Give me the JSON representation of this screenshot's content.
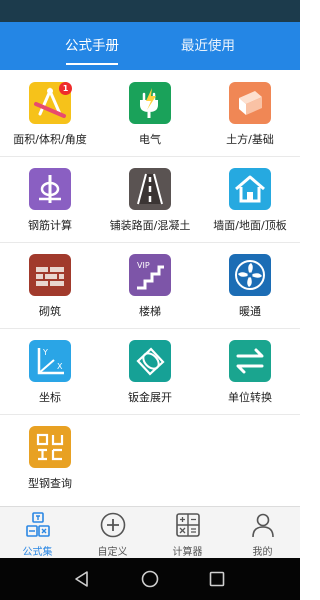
{
  "tabs": [
    {
      "label": "公式手册",
      "active": true
    },
    {
      "label": "最近使用",
      "active": false
    }
  ],
  "grid": {
    "items": [
      {
        "label": "面积/体积/角度",
        "icon": "ruler-compass-icon",
        "color": "#f6c21a",
        "badge": "1"
      },
      {
        "label": "电气",
        "icon": "electric-plug-icon",
        "color": "#1aa25a"
      },
      {
        "label": "土方/基础",
        "icon": "earthwork-block-icon",
        "color": "#f08755"
      },
      {
        "label": "钢筋计算",
        "icon": "rebar-icon",
        "color": "#8a5fc2"
      },
      {
        "label": "铺装路面/混凝土",
        "icon": "road-icon",
        "color": "#5a5352"
      },
      {
        "label": "墙面/地面/顶板",
        "icon": "house-icon",
        "color": "#26a9e0"
      },
      {
        "label": "砌筑",
        "icon": "brick-wall-icon",
        "color": "#a13a2c"
      },
      {
        "label": "楼梯",
        "icon": "stairs-icon",
        "color": "#7d55a8",
        "tag": "VIP"
      },
      {
        "label": "暖通",
        "icon": "fan-icon",
        "color": "#1c6db5"
      },
      {
        "label": "坐标",
        "icon": "coordinate-axes-icon",
        "color": "#2aa5e6",
        "axis_y": "Y",
        "axis_x": "X"
      },
      {
        "label": "钣金展开",
        "icon": "sheet-metal-cylinder-icon",
        "color": "#16a196"
      },
      {
        "label": "单位转换",
        "icon": "swap-arrows-icon",
        "color": "#1aa58f"
      },
      {
        "label": "型钢查询",
        "icon": "steel-section-icon",
        "color": "#e8a123"
      }
    ]
  },
  "bottom_nav": {
    "items": [
      {
        "label": "公式集",
        "icon": "formula-set-icon",
        "active": true
      },
      {
        "label": "自定义",
        "icon": "add-circle-icon",
        "active": false
      },
      {
        "label": "计算器",
        "icon": "calculator-icon",
        "active": false
      },
      {
        "label": "我的",
        "icon": "person-icon",
        "active": false
      }
    ]
  },
  "system_nav": {
    "buttons": [
      {
        "icon": "back-triangle-icon"
      },
      {
        "icon": "home-circle-icon"
      },
      {
        "icon": "recents-square-icon"
      }
    ]
  },
  "colors": {
    "primary": "#2486e5",
    "nav_active": "#2b87e3",
    "status_bar": "#1c3b4c",
    "badge": "#ef2b2b"
  }
}
